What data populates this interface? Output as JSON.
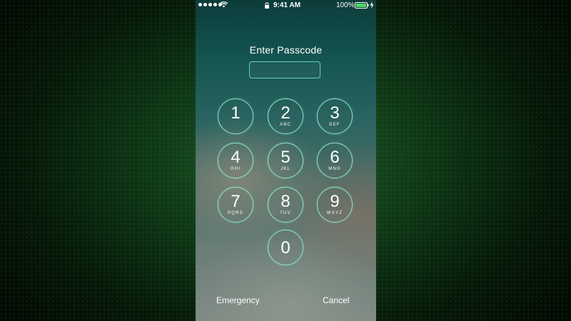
{
  "status_bar": {
    "time": "9:41 AM",
    "battery_percent": "100%",
    "signal_dots": 5,
    "icons": [
      "signal-dots-icon",
      "wifi-icon",
      "lock-icon",
      "battery-icon",
      "charging-bolt-icon"
    ]
  },
  "lock_screen": {
    "title": "Enter Passcode",
    "passcode_value": "",
    "keypad": [
      {
        "digit": "1",
        "letters": ""
      },
      {
        "digit": "2",
        "letters": "ABC"
      },
      {
        "digit": "3",
        "letters": "DEF"
      },
      {
        "digit": "4",
        "letters": "GHI"
      },
      {
        "digit": "5",
        "letters": "JKL"
      },
      {
        "digit": "6",
        "letters": "MNO"
      },
      {
        "digit": "7",
        "letters": "PQRS"
      },
      {
        "digit": "8",
        "letters": "TUV"
      },
      {
        "digit": "9",
        "letters": "WXYZ"
      },
      {
        "digit": "0",
        "letters": ""
      }
    ],
    "emergency_label": "Emergency",
    "cancel_label": "Cancel"
  },
  "colors": {
    "key_ring": "#96f0d2",
    "background_glow": "#1f5c2a"
  }
}
